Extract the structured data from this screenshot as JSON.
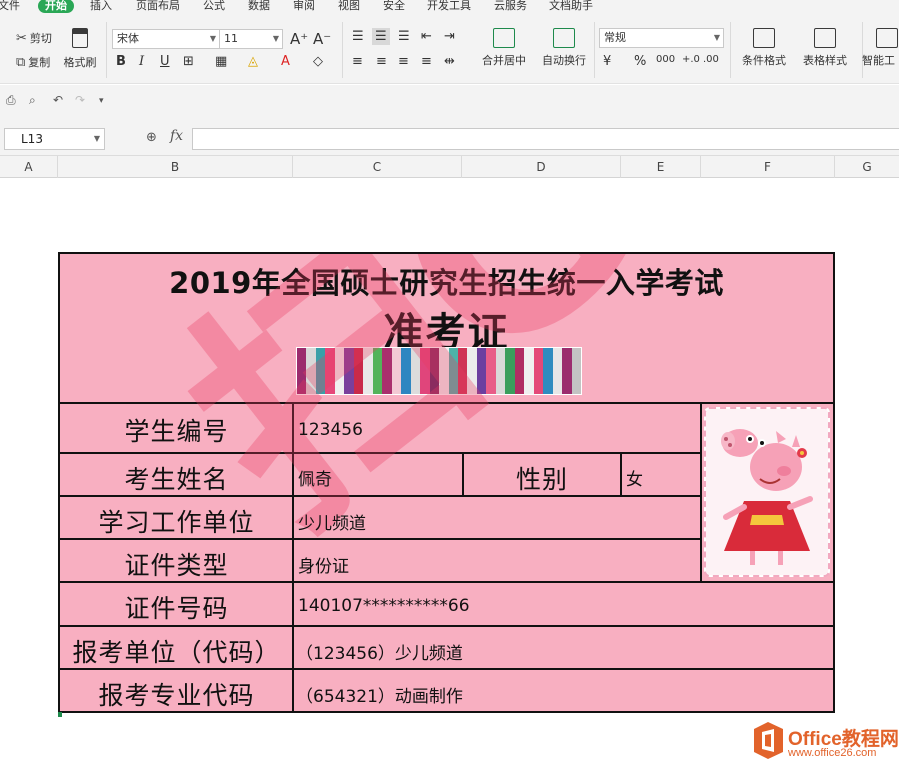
{
  "menu": {
    "items": [
      "文件",
      "开始",
      "插入",
      "页面布局",
      "公式",
      "数据",
      "审阅",
      "视图",
      "安全",
      "开发工具",
      "云服务",
      "文档助手"
    ],
    "active_index": 1
  },
  "ribbon": {
    "cut": "剪切",
    "copy": "复制",
    "format_painter": "格式刷",
    "font_name": "宋体",
    "font_size": "11",
    "font_grow": "A⁺",
    "font_shrink": "A⁻",
    "bold": "B",
    "italic": "I",
    "underline": "U",
    "merge_center": "合并居中",
    "wrap_text": "自动换行",
    "number_format": "常规",
    "currency": "¥",
    "percent": "%",
    "thousands": "000",
    "inc_decimal": "+.0",
    "dec_decimal": ".00",
    "conditional_format": "条件格式",
    "table_style": "表格样式",
    "smart_tool": "智能工"
  },
  "formula_bar": {
    "name_box": "L13",
    "fx": "fx",
    "formula": ""
  },
  "columns": [
    "A",
    "B",
    "C",
    "D",
    "E",
    "F",
    "G"
  ],
  "ticket": {
    "title_line1": "2019年全国硕士研究生招生统一入学考试",
    "title_line2": "准考证",
    "watermark": "扫GO",
    "rows": [
      {
        "label": "学生编号",
        "value": "123456"
      },
      {
        "label": "考生姓名",
        "value": "佩奇",
        "extra_label": "性别",
        "extra_value": "女"
      },
      {
        "label": "学习工作单位",
        "value": "少儿频道"
      },
      {
        "label": "证件类型",
        "value": "身份证"
      },
      {
        "label": "证件号码",
        "value": "140107**********66"
      },
      {
        "label": "报考单位（代码）",
        "value": "（123456）少儿频道"
      },
      {
        "label": "报考专业代码",
        "value": "（654321）动画制作"
      }
    ],
    "colors": {
      "background": "#f8afc1",
      "border": "#111111",
      "watermark": "#e83c5f"
    }
  },
  "barcode_colors": [
    "#9b2c6e",
    "#d8d8d8",
    "#39a0a8",
    "#e6477a",
    "#f0f0f0",
    "#7a3f9c",
    "#c92a4a",
    "#e9e9e9",
    "#53b35a",
    "#aa2f6d",
    "#f3c9d4",
    "#2e86c1",
    "#dcdcdc",
    "#e0457b",
    "#8a2c60",
    "#efefef",
    "#4db3a9",
    "#cf3556",
    "#ececec",
    "#6c3fa0",
    "#e85d88",
    "#d9d9d9",
    "#3a9e5c",
    "#b12d63",
    "#f0f0f0",
    "#e44978",
    "#2f8cbf",
    "#e7e7e7",
    "#9b2c6e",
    "#c3c3c3"
  ],
  "logo": {
    "brand": "Office教程网",
    "url": "www.office26.com",
    "color": "#e2632b"
  }
}
